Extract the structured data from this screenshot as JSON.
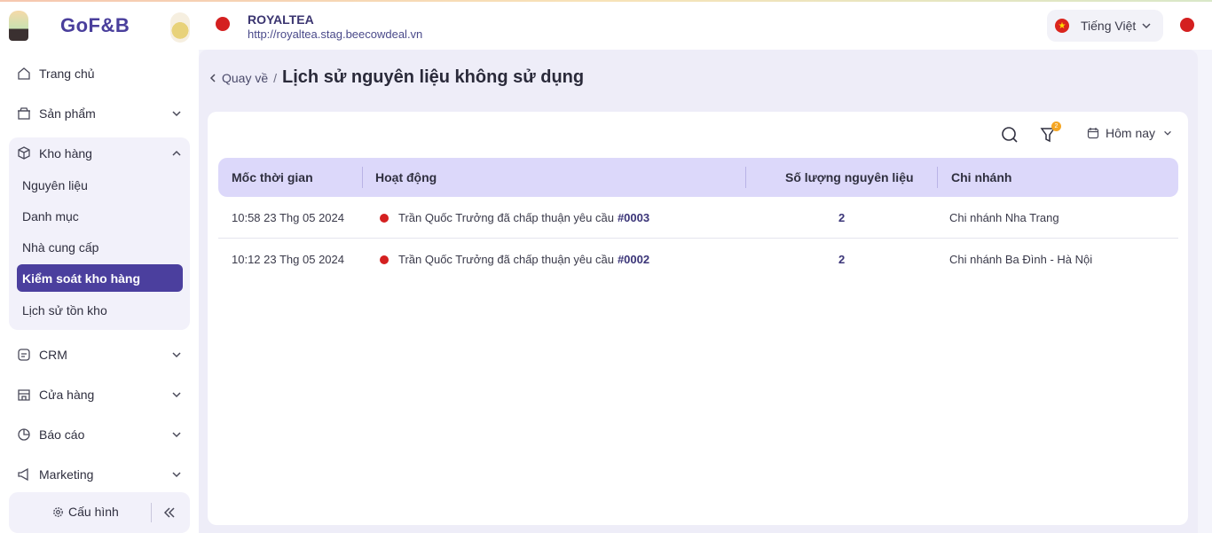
{
  "header": {
    "logo": "GoF&B",
    "brand_name": "ROYALTEA",
    "brand_url": "http://royaltea.stag.beecowdeal.vn",
    "language": "Tiếng Việt"
  },
  "sidebar": {
    "items": [
      {
        "label": "Trang chủ",
        "icon": "home-icon"
      },
      {
        "label": "Sản phẩm",
        "icon": "box-icon"
      },
      {
        "label": "Kho hàng",
        "icon": "cube-icon"
      },
      {
        "label": "CRM",
        "icon": "crm-icon"
      },
      {
        "label": "Cửa hàng",
        "icon": "store-icon"
      },
      {
        "label": "Báo cáo",
        "icon": "chart-pie-icon"
      },
      {
        "label": "Marketing",
        "icon": "megaphone-icon"
      }
    ],
    "warehouse_sub": [
      "Nguyên liệu",
      "Danh mục",
      "Nhà cung cấp",
      "Kiểm soát kho hàng",
      "Lịch sử tồn kho"
    ],
    "config_label": "Cấu hình"
  },
  "main": {
    "back_label": "Quay về",
    "separator": "/",
    "title": "Lịch sử nguyên liệu không sử dụng",
    "filter_badge": "2",
    "date_filter": "Hôm nay",
    "table": {
      "headers": [
        "Mốc thời gian",
        "Hoạt động",
        "Số lượng nguyên liệu",
        "Chi nhánh"
      ],
      "rows": [
        {
          "time": "10:58 23 Thg 05 2024",
          "activity": "Trần Quốc Trưởng đã chấp thuận yêu cầu",
          "code": "#0003",
          "qty": "2",
          "branch": "Chi nhánh Nha Trang"
        },
        {
          "time": "10:12 23 Thg 05 2024",
          "activity": "Trần Quốc Trưởng đã chấp thuận yêu cầu",
          "code": "#0002",
          "qty": "2",
          "branch": "Chi nhánh Ba Đình - Hà Nội"
        }
      ]
    }
  },
  "colors": {
    "accent": "#4b3f9e",
    "header_row": "#dcd8fa",
    "badge": "#f5a623"
  }
}
